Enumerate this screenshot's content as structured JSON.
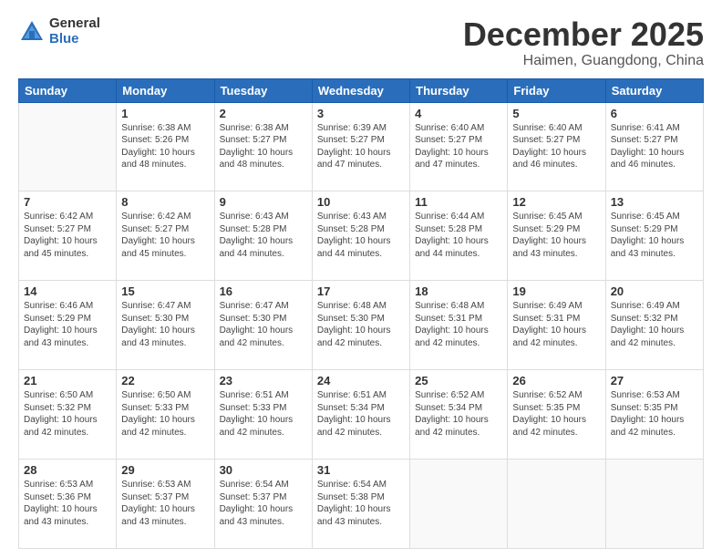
{
  "header": {
    "logo_general": "General",
    "logo_blue": "Blue",
    "month_title": "December 2025",
    "location": "Haimen, Guangdong, China"
  },
  "weekdays": [
    "Sunday",
    "Monday",
    "Tuesday",
    "Wednesday",
    "Thursday",
    "Friday",
    "Saturday"
  ],
  "weeks": [
    [
      {
        "day": null,
        "info": ""
      },
      {
        "day": "1",
        "info": "Sunrise: 6:38 AM\nSunset: 5:26 PM\nDaylight: 10 hours\nand 48 minutes."
      },
      {
        "day": "2",
        "info": "Sunrise: 6:38 AM\nSunset: 5:27 PM\nDaylight: 10 hours\nand 48 minutes."
      },
      {
        "day": "3",
        "info": "Sunrise: 6:39 AM\nSunset: 5:27 PM\nDaylight: 10 hours\nand 47 minutes."
      },
      {
        "day": "4",
        "info": "Sunrise: 6:40 AM\nSunset: 5:27 PM\nDaylight: 10 hours\nand 47 minutes."
      },
      {
        "day": "5",
        "info": "Sunrise: 6:40 AM\nSunset: 5:27 PM\nDaylight: 10 hours\nand 46 minutes."
      },
      {
        "day": "6",
        "info": "Sunrise: 6:41 AM\nSunset: 5:27 PM\nDaylight: 10 hours\nand 46 minutes."
      }
    ],
    [
      {
        "day": "7",
        "info": "Sunrise: 6:42 AM\nSunset: 5:27 PM\nDaylight: 10 hours\nand 45 minutes."
      },
      {
        "day": "8",
        "info": "Sunrise: 6:42 AM\nSunset: 5:27 PM\nDaylight: 10 hours\nand 45 minutes."
      },
      {
        "day": "9",
        "info": "Sunrise: 6:43 AM\nSunset: 5:28 PM\nDaylight: 10 hours\nand 44 minutes."
      },
      {
        "day": "10",
        "info": "Sunrise: 6:43 AM\nSunset: 5:28 PM\nDaylight: 10 hours\nand 44 minutes."
      },
      {
        "day": "11",
        "info": "Sunrise: 6:44 AM\nSunset: 5:28 PM\nDaylight: 10 hours\nand 44 minutes."
      },
      {
        "day": "12",
        "info": "Sunrise: 6:45 AM\nSunset: 5:29 PM\nDaylight: 10 hours\nand 43 minutes."
      },
      {
        "day": "13",
        "info": "Sunrise: 6:45 AM\nSunset: 5:29 PM\nDaylight: 10 hours\nand 43 minutes."
      }
    ],
    [
      {
        "day": "14",
        "info": "Sunrise: 6:46 AM\nSunset: 5:29 PM\nDaylight: 10 hours\nand 43 minutes."
      },
      {
        "day": "15",
        "info": "Sunrise: 6:47 AM\nSunset: 5:30 PM\nDaylight: 10 hours\nand 43 minutes."
      },
      {
        "day": "16",
        "info": "Sunrise: 6:47 AM\nSunset: 5:30 PM\nDaylight: 10 hours\nand 42 minutes."
      },
      {
        "day": "17",
        "info": "Sunrise: 6:48 AM\nSunset: 5:30 PM\nDaylight: 10 hours\nand 42 minutes."
      },
      {
        "day": "18",
        "info": "Sunrise: 6:48 AM\nSunset: 5:31 PM\nDaylight: 10 hours\nand 42 minutes."
      },
      {
        "day": "19",
        "info": "Sunrise: 6:49 AM\nSunset: 5:31 PM\nDaylight: 10 hours\nand 42 minutes."
      },
      {
        "day": "20",
        "info": "Sunrise: 6:49 AM\nSunset: 5:32 PM\nDaylight: 10 hours\nand 42 minutes."
      }
    ],
    [
      {
        "day": "21",
        "info": "Sunrise: 6:50 AM\nSunset: 5:32 PM\nDaylight: 10 hours\nand 42 minutes."
      },
      {
        "day": "22",
        "info": "Sunrise: 6:50 AM\nSunset: 5:33 PM\nDaylight: 10 hours\nand 42 minutes."
      },
      {
        "day": "23",
        "info": "Sunrise: 6:51 AM\nSunset: 5:33 PM\nDaylight: 10 hours\nand 42 minutes."
      },
      {
        "day": "24",
        "info": "Sunrise: 6:51 AM\nSunset: 5:34 PM\nDaylight: 10 hours\nand 42 minutes."
      },
      {
        "day": "25",
        "info": "Sunrise: 6:52 AM\nSunset: 5:34 PM\nDaylight: 10 hours\nand 42 minutes."
      },
      {
        "day": "26",
        "info": "Sunrise: 6:52 AM\nSunset: 5:35 PM\nDaylight: 10 hours\nand 42 minutes."
      },
      {
        "day": "27",
        "info": "Sunrise: 6:53 AM\nSunset: 5:35 PM\nDaylight: 10 hours\nand 42 minutes."
      }
    ],
    [
      {
        "day": "28",
        "info": "Sunrise: 6:53 AM\nSunset: 5:36 PM\nDaylight: 10 hours\nand 43 minutes."
      },
      {
        "day": "29",
        "info": "Sunrise: 6:53 AM\nSunset: 5:37 PM\nDaylight: 10 hours\nand 43 minutes."
      },
      {
        "day": "30",
        "info": "Sunrise: 6:54 AM\nSunset: 5:37 PM\nDaylight: 10 hours\nand 43 minutes."
      },
      {
        "day": "31",
        "info": "Sunrise: 6:54 AM\nSunset: 5:38 PM\nDaylight: 10 hours\nand 43 minutes."
      },
      {
        "day": null,
        "info": ""
      },
      {
        "day": null,
        "info": ""
      },
      {
        "day": null,
        "info": ""
      }
    ]
  ]
}
